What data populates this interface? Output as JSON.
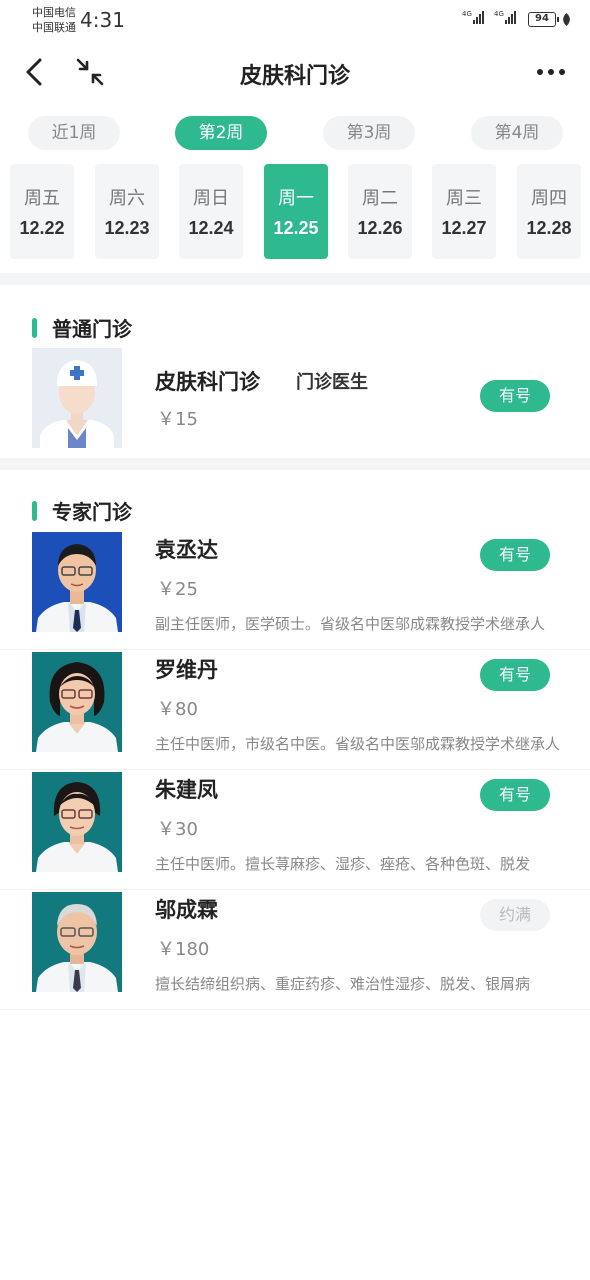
{
  "status_bar": {
    "carrier_1": "中国电信",
    "carrier_2": "中国联通",
    "time": "4:31",
    "signal_1_label": "4G",
    "signal_2_label": "4G",
    "battery": "94"
  },
  "nav": {
    "title": "皮肤科门诊"
  },
  "week_tabs": [
    {
      "label": "近1周",
      "active": false
    },
    {
      "label": "第2周",
      "active": true
    },
    {
      "label": "第3周",
      "active": false
    },
    {
      "label": "第4周",
      "active": false
    }
  ],
  "days": [
    {
      "weekday": "周五",
      "date": "12.22",
      "active": false
    },
    {
      "weekday": "周六",
      "date": "12.23",
      "active": false
    },
    {
      "weekday": "周日",
      "date": "12.24",
      "active": false
    },
    {
      "weekday": "周一",
      "date": "12.25",
      "active": true
    },
    {
      "weekday": "周二",
      "date": "12.26",
      "active": false
    },
    {
      "weekday": "周三",
      "date": "12.27",
      "active": false
    },
    {
      "weekday": "周四",
      "date": "12.28",
      "active": false
    }
  ],
  "general_clinic": {
    "section_title": "普通门诊",
    "name": "皮肤科门诊",
    "title": "门诊医生",
    "fee": "￥15",
    "status": "有号"
  },
  "expert_clinic": {
    "section_title": "专家门诊",
    "doctors": [
      {
        "name": "袁丞达",
        "fee": "￥25",
        "desc": "副主任医师，医学硕士。省级名中医邬成霖教授学术继承人",
        "status": "有号"
      },
      {
        "name": "罗维丹",
        "fee": "￥80",
        "desc": "主任中医师，市级名中医。省级名中医邬成霖教授学术继承人",
        "status": "有号"
      },
      {
        "name": "朱建凤",
        "fee": "￥30",
        "desc": "主任中医师。擅长荨麻疹、湿疹、痤疮、各种色斑、脱发",
        "status": "有号"
      },
      {
        "name": "邬成霖",
        "fee": "￥180",
        "desc": "擅长结缔组织病、重症药疹、难治性湿疹、脱发、银屑病",
        "status": "约满"
      }
    ]
  },
  "colors": {
    "accent": "#2eb98f",
    "tab_bg": "#f2f3f5",
    "muted_text": "#888888"
  }
}
